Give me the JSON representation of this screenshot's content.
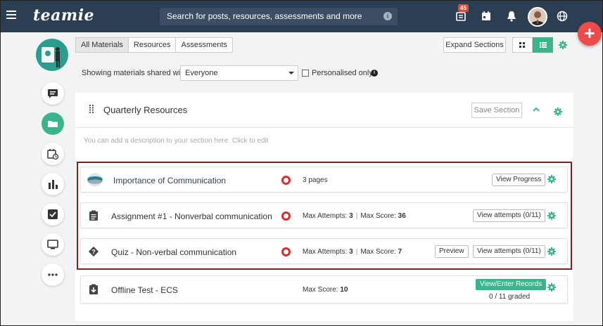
{
  "header": {
    "logo": "teamie",
    "search_placeholder": "Search for posts, resources, assessments and more",
    "notification_count": "45"
  },
  "toolbar": {
    "tabs": [
      {
        "label": "All Materials",
        "active": true
      },
      {
        "label": "Resources",
        "active": false
      },
      {
        "label": "Assessments",
        "active": false
      }
    ],
    "expand_label": "Expand Sections"
  },
  "filter": {
    "label": "Showing materials shared with",
    "selected": "Everyone",
    "personalised_label": "Personalised only",
    "personalised_checked": false
  },
  "section": {
    "title": "Quarterly Resources",
    "save_label": "Save Section",
    "description": "You can add a description to your section here. Click to edit"
  },
  "items": [
    {
      "title": "Importance of Communication",
      "type": "resource",
      "meta": "3 pages",
      "buttons": [
        "View Progress"
      ]
    },
    {
      "title": "Assignment #1 - Nonverbal communication",
      "type": "assignment",
      "attempts_label": "Max Attempts:",
      "attempts": "3",
      "score_label": "Max Score:",
      "score": "36",
      "buttons": [
        "View attempts (0/11)"
      ]
    },
    {
      "title": "Quiz - Non-verbal communication",
      "type": "quiz",
      "attempts_label": "Max Attempts:",
      "attempts": "3",
      "score_label": "Max Score:",
      "score": "7",
      "buttons": [
        "Preview",
        "View attempts (0/11)"
      ]
    },
    {
      "title": "Offline Test - ECS",
      "type": "offline-test",
      "score_label": "Max Score:",
      "score": "10",
      "buttons": [
        "View/Enter Records"
      ],
      "graded": "0 / 11 graded"
    }
  ],
  "colors": {
    "topbar": "#2c3e52",
    "accent_green": "#3cb48a",
    "status_red": "#d32f2f",
    "fab_red": "#ef4a4a",
    "highlight": "#8b1a1a"
  },
  "icons": {
    "sidebar": [
      "chat-icon",
      "folder-icon",
      "calendar-clock-icon",
      "bar-chart-icon",
      "checkbox-icon",
      "monitor-icon",
      "more-icon"
    ]
  }
}
